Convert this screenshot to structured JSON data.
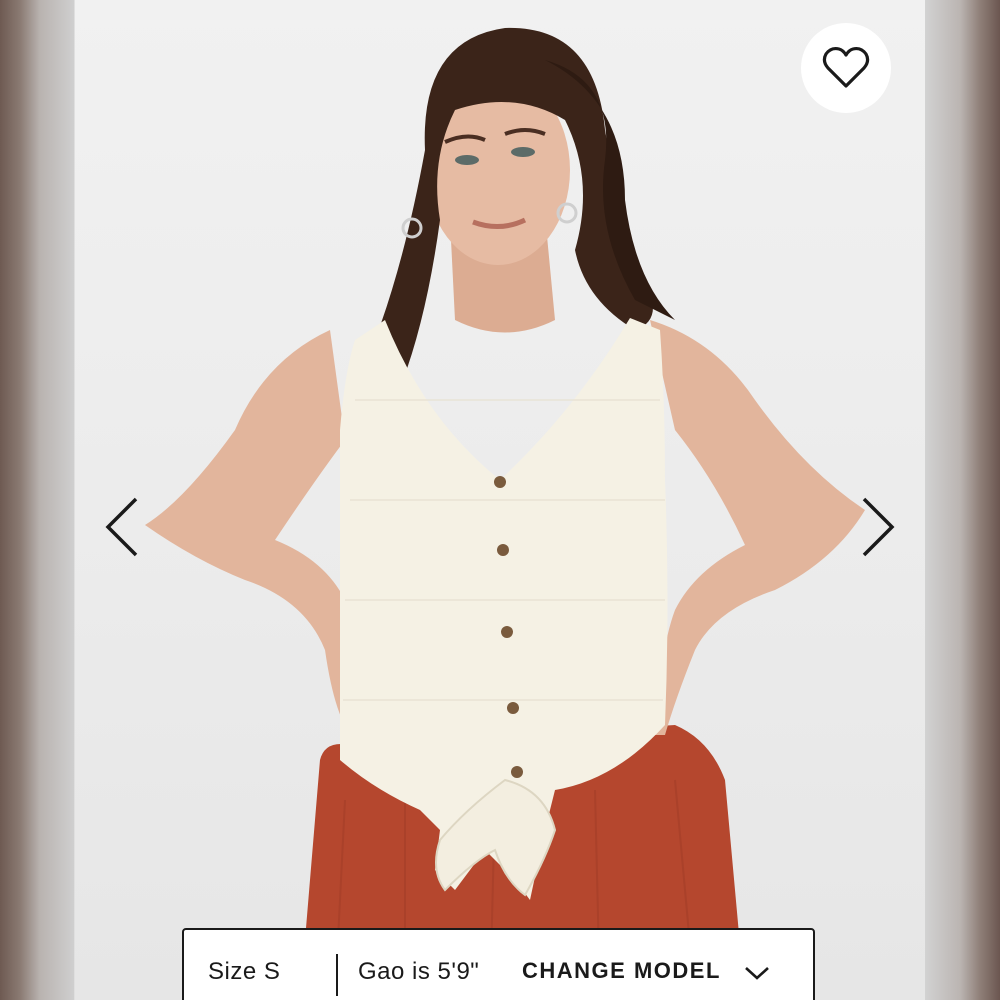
{
  "size_selector": {
    "size_label": "Size S",
    "model_height": "Gao is 5'9\"",
    "change_model_label": "CHANGE MODEL"
  },
  "icons": {
    "favorite": "heart-outline-icon",
    "previous": "chevron-left-icon",
    "next": "chevron-right-icon",
    "dropdown": "chevron-down-icon"
  },
  "colors": {
    "background": "#efefef",
    "top_garment": "#f5f1e4",
    "bottom_garment": "#b5472e",
    "hair": "#3b2419",
    "skin": "#e2b59c",
    "text": "#1a1a1a"
  }
}
